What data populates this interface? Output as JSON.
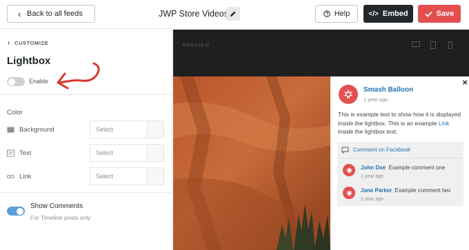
{
  "topbar": {
    "back_label": "Back to all feeds",
    "feed_title": "JWP Store Videos",
    "help_label": "Help",
    "embed_label": "Embed",
    "save_label": "Save"
  },
  "sidebar": {
    "breadcrumb": "CUSTOMIZE",
    "title": "Lightbox",
    "enable_label": "Enable",
    "enable_on": false,
    "color_section": "Color",
    "color_rows": [
      {
        "label": "Background",
        "placeholder": "Select",
        "icon": "background-icon"
      },
      {
        "label": "Text",
        "placeholder": "Select",
        "icon": "text-icon"
      },
      {
        "label": "Link",
        "placeholder": "Select",
        "icon": "link-icon"
      }
    ],
    "show_comments_label": "Show Comments",
    "show_comments_sub": "For Timeline posts only",
    "show_comments_on": true
  },
  "preview": {
    "label": "PREVIEW",
    "devices": [
      "desktop-icon",
      "tablet-icon",
      "mobile-icon"
    ],
    "lightbox": {
      "close": "×",
      "author": "Smash Balloon",
      "time": "1 year ago",
      "text_before_link": "This is example text to show how it is displayed inside the lightbox. This is an example ",
      "link_text": "Link",
      "text_after_link": " inside the lightbox text.",
      "comments_header": "Comment on Facebook",
      "comments": [
        {
          "name": "John Doe",
          "text": "Example comment one",
          "time": "1 year ago"
        },
        {
          "name": "Jane Parker",
          "text": "Example comment two",
          "time": "1 year ago"
        }
      ]
    }
  },
  "colors": {
    "accent": "#2271b1",
    "save": "#e34f4f",
    "embed": "#23282d",
    "arrow": "#d9362b",
    "toggle_on": "#5b9dd9"
  }
}
